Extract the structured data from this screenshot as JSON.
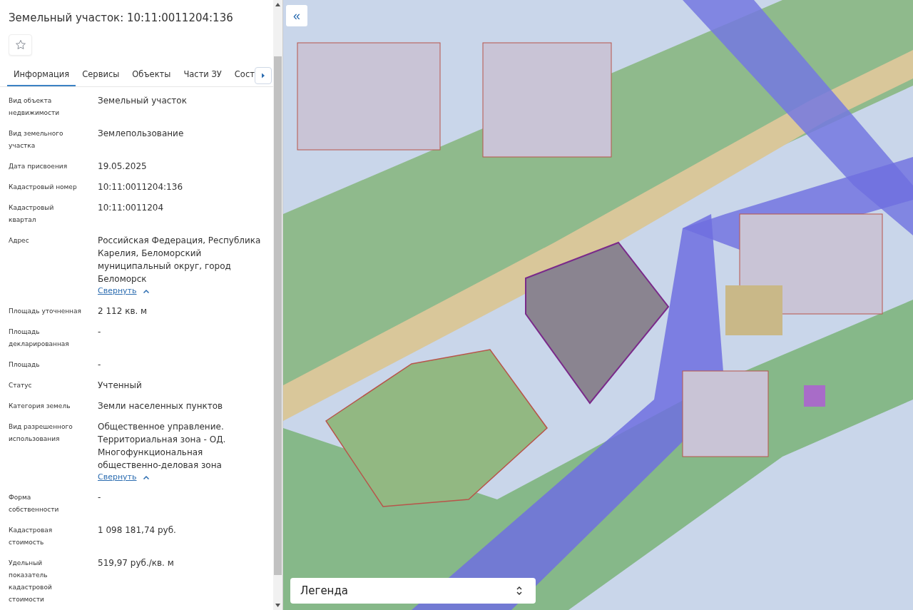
{
  "panel": {
    "title": "Земельный участок: 10:11:0011204:136",
    "tabs": [
      {
        "label": "Информация",
        "selected": true
      },
      {
        "label": "Сервисы",
        "selected": false
      },
      {
        "label": "Объекты",
        "selected": false
      },
      {
        "label": "Части ЗУ",
        "selected": false
      },
      {
        "label": "Сост",
        "selected": false
      }
    ],
    "fields": [
      {
        "label": "Вид объекта недвижимости",
        "value": "Земельный участок"
      },
      {
        "label": "Вид земельного участка",
        "value": "Землепользование"
      },
      {
        "label": "Дата присвоения",
        "value": "19.05.2025"
      },
      {
        "label": "Кадастровый номер",
        "value": "10:11:0011204:136"
      },
      {
        "label": "Кадастровый квартал",
        "value": "10:11:0011204"
      },
      {
        "label": "Адрес",
        "value": "Российская Федерация, Республика Карелия, Беломорский муниципальный округ, город Беломорск",
        "collapse_link": "Свернуть"
      },
      {
        "label": "Площадь уточненная",
        "value": "2 112 кв. м"
      },
      {
        "label": "Площадь декларированная",
        "value": "-"
      },
      {
        "label": "Площадь",
        "value": "-"
      },
      {
        "label": "Статус",
        "value": "Учтенный"
      },
      {
        "label": "Категория земель",
        "value": "Земли населенных пунктов"
      },
      {
        "label": "Вид разрешенного использования",
        "value": "Общественное управление. Территориальная зона - ОД. Многофункциональная общественно-деловая зона",
        "collapse_link": "Свернуть"
      },
      {
        "label": "Форма собственности",
        "value": "-"
      },
      {
        "label": "Кадастровая стоимость",
        "value": "1 098 181,74 руб."
      },
      {
        "label": "Удельный показатель кадастровой стоимости",
        "value": "519,97 руб./кв. м"
      }
    ]
  },
  "map": {
    "kind": "picture",
    "legend": {
      "label": "Легенда"
    },
    "collapse_button": "«"
  }
}
